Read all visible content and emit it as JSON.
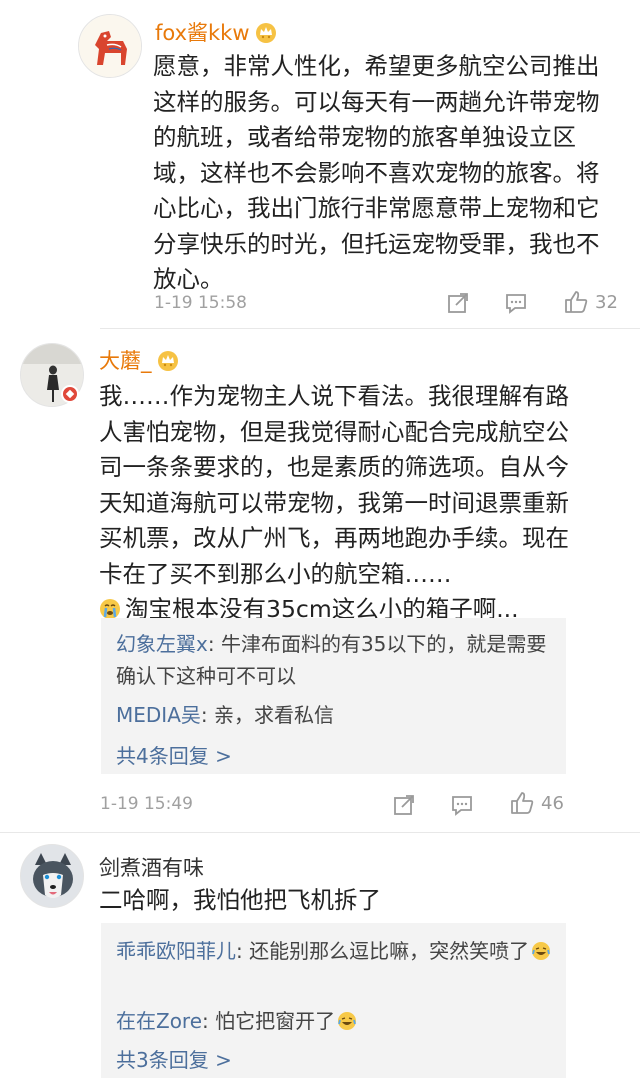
{
  "comments": [
    {
      "username": "fox酱kkw",
      "text": "愿意，非常人性化，希望更多航空公司推出这样的服务。可以每天有一两趟允许带宠物的航班，或者给带宠物的旅客单独设立区域，这样也不会影响不喜欢宠物的旅客。将心比心，我出门旅行非常愿意带上宠物和它分享快乐的时光，但托运宠物受罪，我也不放心。",
      "time": "1-19 15:58",
      "likes": "32"
    },
    {
      "username": "大蘑_",
      "text": "我……作为宠物主人说下看法。我很理解有路人害怕宠物，但是我觉得耐心配合完成航空公司一条条要求的，也是素质的筛选项。自从今天知道海航可以带宠物，我第一时间退票重新买机票，改从广州飞，再两地跑办手续。现在卡在了买不到那么小的航空箱……",
      "text_tail": "淘宝根本没有35cm这么小的箱子啊...",
      "replies": [
        {
          "name": "幻象左翼x",
          "text": ": 牛津布面料的有35以下的，就是需要确认下这种可不可以"
        },
        {
          "name": "MEDIA吴",
          "text": ": 亲，求看私信"
        }
      ],
      "more_replies": "共4条回复 >",
      "time": "1-19 15:49",
      "likes": "46"
    },
    {
      "username": "剑煮酒有味",
      "text": "二哈啊，我怕他把飞机拆了",
      "replies": [
        {
          "name": "乖乖欧阳菲儿",
          "text": ": 还能别那么逗比嘛，突然笑喷了"
        },
        {
          "name": "在在Zore",
          "text": ": 怕它把窗开了"
        }
      ],
      "more_replies": "共3条回复 >"
    }
  ],
  "colors": {
    "username_vip": "#e8790a",
    "reply_name": "#4c6f9c",
    "meta": "#a0a0a0",
    "reply_bg": "#f3f3f3"
  },
  "icons": {
    "repost": "share-icon",
    "comment": "comment-icon",
    "like": "thumbs-up-icon",
    "crown": "crown-badge-icon"
  }
}
